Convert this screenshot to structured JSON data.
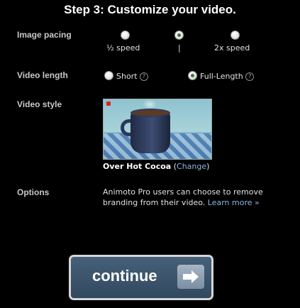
{
  "title": "Step 3: Customize your video.",
  "image_pacing": {
    "label": "Image pacing",
    "options": [
      "½ speed",
      "|",
      "2x speed"
    ],
    "selected_index": 1
  },
  "video_length": {
    "label": "Video length",
    "short": "Short",
    "full": "Full-Length",
    "help": "?",
    "selected": "Full-Length"
  },
  "video_style": {
    "label": "Video style",
    "name": "Over Hot Cocoa",
    "change": "Change"
  },
  "options": {
    "label": "Options",
    "text": "Animoto Pro users can choose to remove branding from their video.",
    "learn_more": "Learn more »"
  },
  "continue_button": {
    "label": "continue"
  }
}
